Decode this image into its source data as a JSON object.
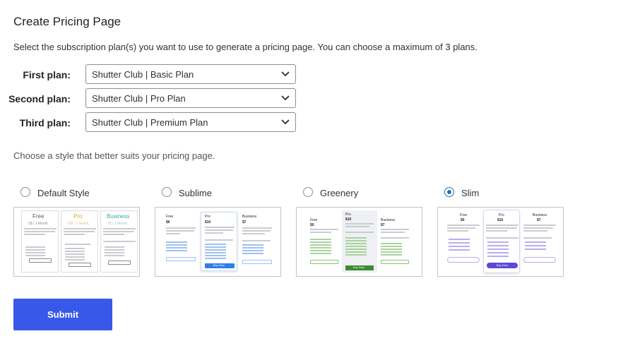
{
  "header": {
    "title": "Create Pricing Page",
    "description": "Select the subscription plan(s) you want to use to generate a pricing page. You can choose a maximum of 3 plans."
  },
  "plans": [
    {
      "label": "First plan:",
      "value": "Shutter Club | Basic Plan"
    },
    {
      "label": "Second plan:",
      "value": "Shutter Club | Pro Plan"
    },
    {
      "label": "Third plan:",
      "value": "Shutter Club | Premium Plan"
    }
  ],
  "styles": {
    "description": "Choose a style that better suits your pricing page.",
    "options": [
      {
        "name": "Default Style",
        "selected": false
      },
      {
        "name": "Sublime",
        "selected": false
      },
      {
        "name": "Greenery",
        "selected": false
      },
      {
        "name": "Slim",
        "selected": true
      }
    ]
  },
  "previews": {
    "default": {
      "tiers": [
        "Free",
        "Pro",
        "Business"
      ],
      "prices": [
        "0$ / 1 Month",
        "10$ / 1 Month",
        "7$ / 1 Month"
      ]
    },
    "sublime": {
      "tiers": [
        "Free",
        "Pro",
        "Business"
      ],
      "prices": [
        "$0",
        "$10",
        "$7"
      ],
      "buy": "Buy Now"
    },
    "greenery": {
      "tiers": [
        "Free",
        "Pro",
        "Business"
      ],
      "prices": [
        "$0",
        "$10",
        "$7"
      ],
      "buy": "Buy Now"
    },
    "slim": {
      "tiers": [
        "Free",
        "Pro",
        "Business"
      ],
      "prices": [
        "$0",
        "$10",
        "$7"
      ],
      "buy": "Buy Now"
    }
  },
  "submit_label": "Submit",
  "colors": {
    "accent": "#3858e9",
    "radio": "#2271b1",
    "default_free": "#555d66",
    "default_pro": "#d4a72c",
    "default_business": "#3aa89b",
    "sublime_button": "#2f7fe8",
    "greenery_button": "#3e8a2e",
    "slim_button": "#5b4ad8"
  }
}
